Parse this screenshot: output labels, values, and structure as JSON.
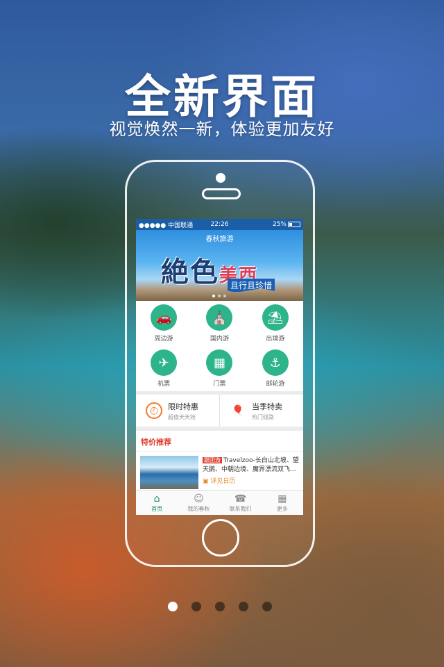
{
  "headline": "全新界面",
  "subline": "视觉焕然一新，体验更加友好",
  "status": {
    "carrier": "●●●●● 中国联通",
    "time": "22:26",
    "battery": "25%",
    "battery_level": 0.25
  },
  "banner": {
    "logo": "春秋旅游",
    "title": "絶色",
    "title_red": "美西",
    "tag": "且行且珍惜"
  },
  "grid": [
    {
      "label": "周边游",
      "icon": "car-icon"
    },
    {
      "label": "国内游",
      "icon": "temple-icon"
    },
    {
      "label": "出境游",
      "icon": "beach-umbrella-icon"
    },
    {
      "label": "机票",
      "icon": "plane-icon"
    },
    {
      "label": "门票",
      "icon": "ticket-icon"
    },
    {
      "label": "邮轮游",
      "icon": "cruise-ship-icon"
    }
  ],
  "promo": [
    {
      "title": "限时特惠",
      "sub": "超值天天抢",
      "icon": "clock-icon",
      "color": "#f07a2a"
    },
    {
      "title": "当季特卖",
      "sub": "热门线路",
      "icon": "balloon-icon",
      "color": "#8cc63f"
    }
  ],
  "section_title": "特价推荐",
  "deal": {
    "badge": "跟团游",
    "text": "Travelzoo-长白山北坡、望天鹅、中朝边境、魔界漂流双飞...",
    "link": "详见日历"
  },
  "tabs": [
    {
      "label": "首页",
      "icon": "home-icon"
    },
    {
      "label": "我的春秋",
      "icon": "profile-icon"
    },
    {
      "label": "联系我们",
      "icon": "phone-icon"
    },
    {
      "label": "更多",
      "icon": "grid-icon"
    }
  ],
  "pager": {
    "count": 5,
    "active": 0
  }
}
